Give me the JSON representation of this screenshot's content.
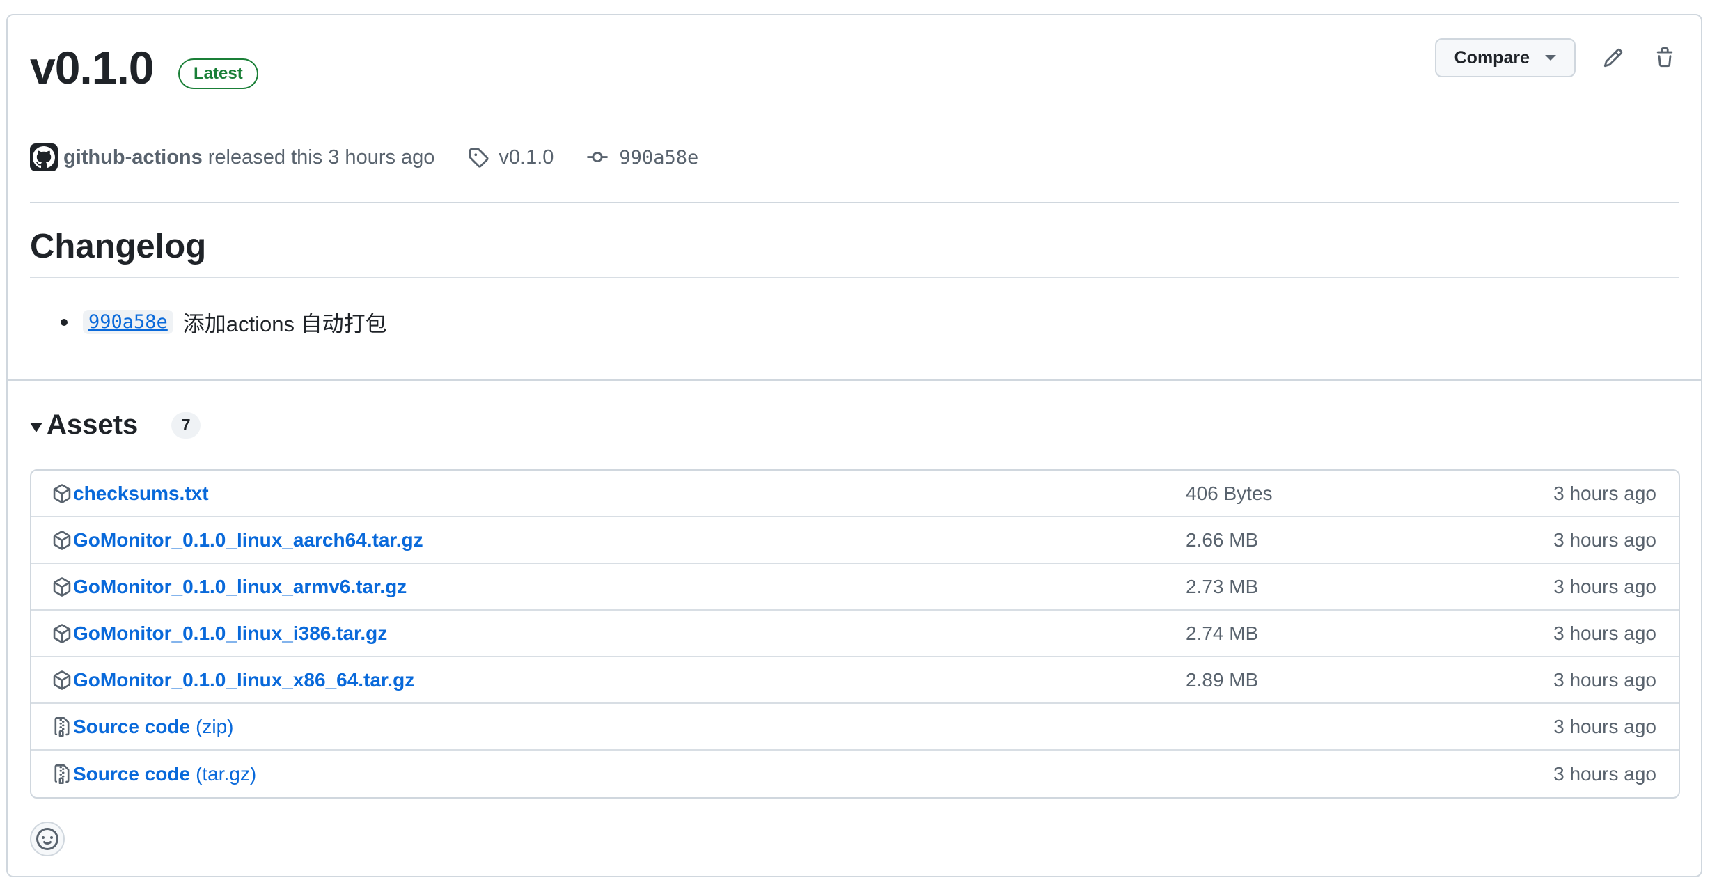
{
  "release": {
    "title": "v0.1.0",
    "badge": "Latest",
    "author": "github-actions",
    "released_text": "released this 3 hours ago",
    "tag": "v0.1.0",
    "commit": "990a58e"
  },
  "actions": {
    "compare_label": "Compare"
  },
  "changelog": {
    "heading": "Changelog",
    "items": [
      {
        "commit": "990a58e",
        "text": "添加actions 自动打包"
      }
    ]
  },
  "assets": {
    "heading": "Assets",
    "count": "7",
    "rows": [
      {
        "name": "checksums.txt",
        "suffix": "",
        "size": "406 Bytes",
        "time": "3 hours ago",
        "icon": "package-icon"
      },
      {
        "name": "GoMonitor_0.1.0_linux_aarch64.tar.gz",
        "suffix": "",
        "size": "2.66 MB",
        "time": "3 hours ago",
        "icon": "package-icon"
      },
      {
        "name": "GoMonitor_0.1.0_linux_armv6.tar.gz",
        "suffix": "",
        "size": "2.73 MB",
        "time": "3 hours ago",
        "icon": "package-icon"
      },
      {
        "name": "GoMonitor_0.1.0_linux_i386.tar.gz",
        "suffix": "",
        "size": "2.74 MB",
        "time": "3 hours ago",
        "icon": "package-icon"
      },
      {
        "name": "GoMonitor_0.1.0_linux_x86_64.tar.gz",
        "suffix": "",
        "size": "2.89 MB",
        "time": "3 hours ago",
        "icon": "package-icon"
      },
      {
        "name": "Source code",
        "suffix": "(zip)",
        "size": "",
        "time": "3 hours ago",
        "icon": "file-zip-icon"
      },
      {
        "name": "Source code",
        "suffix": "(tar.gz)",
        "size": "",
        "time": "3 hours ago",
        "icon": "file-zip-icon"
      }
    ]
  },
  "colors": {
    "link": "#0969da",
    "badge_green": "#1a7f37",
    "muted": "#59636e",
    "border": "#d0d7de"
  }
}
